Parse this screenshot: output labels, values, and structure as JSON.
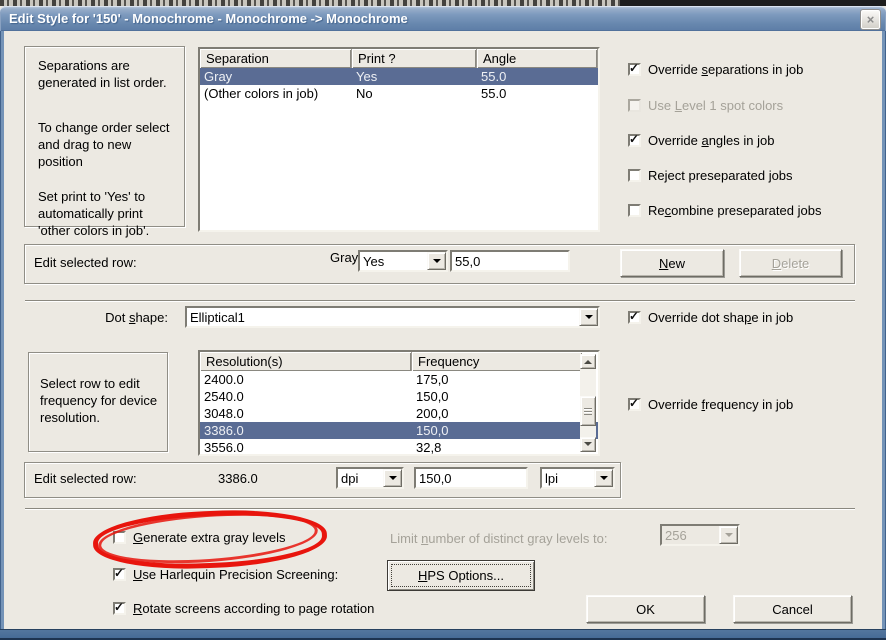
{
  "window": {
    "title": "Edit Style for '150' - Monochrome - Monochrome -> Monochrome",
    "close_glyph": "×"
  },
  "instructions": {
    "para1": "Separations are generated in list order.",
    "para2": "To change order select and drag to new position",
    "para3": "Set print to 'Yes' to automatically print 'other colors in job'."
  },
  "separations_table": {
    "headers": [
      "Separation",
      "Print ?",
      "Angle"
    ],
    "rows": [
      [
        "Gray",
        "Yes",
        "55.0"
      ],
      [
        "(Other colors in job)",
        "No",
        "55.0"
      ]
    ],
    "selected_row": 0
  },
  "job_options": [
    {
      "pre": "Override ",
      "key": "s",
      "post": "eparations in job",
      "checked": true,
      "disabled": false
    },
    {
      "pre": "Use ",
      "key": "L",
      "post": "evel 1 spot colors",
      "checked": false,
      "disabled": true
    },
    {
      "pre": "Override ",
      "key": "a",
      "post": "ngles in job",
      "checked": true,
      "disabled": false
    },
    {
      "pre": "Re",
      "key": "j",
      "post": "ect preseparated jobs",
      "checked": false,
      "disabled": false
    },
    {
      "pre": "Re",
      "key": "c",
      "post": "ombine preseparated jobs",
      "checked": false,
      "disabled": false
    }
  ],
  "edit_separation": {
    "label": "Edit selected row:",
    "selected_name": "Gray",
    "print_value": "Yes",
    "angle_value": "55,0",
    "new_button": {
      "pre": "",
      "key": "N",
      "post": "ew"
    },
    "delete_button": {
      "pre": "",
      "key": "D",
      "post": "elete",
      "disabled": true
    }
  },
  "dot_shape": {
    "label": {
      "pre": "Dot ",
      "key": "s",
      "post": "hape:"
    },
    "value": "Elliptical1",
    "override": {
      "pre": "Override dot sha",
      "key": "p",
      "post": "e in job",
      "checked": true
    }
  },
  "frequency_section": {
    "hint": "Select row to edit frequency for device resolution.",
    "table": {
      "headers": [
        "Resolution(s)",
        "Frequency"
      ],
      "rows": [
        [
          "2400.0",
          "175,0"
        ],
        [
          "2540.0",
          "150,0"
        ],
        [
          "3048.0",
          "200,0"
        ],
        [
          "3386.0",
          "150,0"
        ],
        [
          "3556.0",
          "32,8"
        ]
      ],
      "selected_row": 3
    },
    "override": {
      "pre": "Override ",
      "key": "f",
      "post": "requency in job",
      "checked": true
    },
    "edit": {
      "label": "Edit selected row:",
      "selected_resolution": "3386.0",
      "unit1": "dpi",
      "frequency_value": "150,0",
      "unit2": "lpi"
    }
  },
  "gray_levels": {
    "generate": {
      "pre": "",
      "key": "G",
      "post": "enerate extra gray levels",
      "checked": false
    },
    "limit_label": {
      "pre": "Limit ",
      "key": "n",
      "post": "umber of distinct gray levels to:",
      "disabled": true
    },
    "limit_value": "256"
  },
  "hps": {
    "checkbox": {
      "pre": "",
      "key": "U",
      "post": "se Harlequin Precision Screening:",
      "checked": true
    },
    "button": {
      "pre": "",
      "key": "H",
      "post": "PS Options..."
    }
  },
  "rotate_screens": {
    "pre": "",
    "key": "R",
    "post": "otate screens according to page rotation",
    "checked": true
  },
  "footer": {
    "ok": "OK",
    "cancel": "Cancel"
  },
  "colors": {
    "dialog_bg": "#ece9e2",
    "titlebar_top": "#c3d0e1",
    "titlebar_bottom": "#5d7da6",
    "selection_bg": "#5a6c94",
    "selection_text": "#eef0f4",
    "disabled_text": "#a5a299",
    "annotation_red": "#e8150d"
  }
}
